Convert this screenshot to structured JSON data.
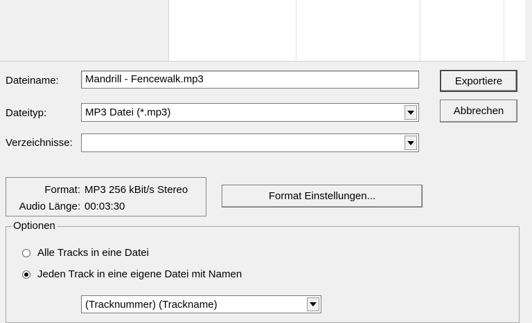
{
  "filename": {
    "label": "Dateiname:",
    "value": "Mandrill - Fencewalk.mp3"
  },
  "filetype": {
    "label": "Dateityp:",
    "value": "MP3 Datei (*.mp3)"
  },
  "directories": {
    "label": "Verzeichnisse:",
    "value": ""
  },
  "buttons": {
    "export": "Exportiere",
    "cancel": "Abbrechen",
    "format_settings": "Format Einstellungen..."
  },
  "info": {
    "format_label": "Format:",
    "format_value": "MP3 256 kBit/s Stereo",
    "length_label": "Audio Länge:",
    "length_value": "00:03:30"
  },
  "options": {
    "title": "Optionen",
    "radio_all": {
      "label": "Alle Tracks in eine Datei",
      "checked": false
    },
    "radio_each": {
      "label": "Jeden Track in eine eigene Datei mit Namen",
      "checked": true
    },
    "naming_value": "(Tracknummer) (Trackname)"
  }
}
